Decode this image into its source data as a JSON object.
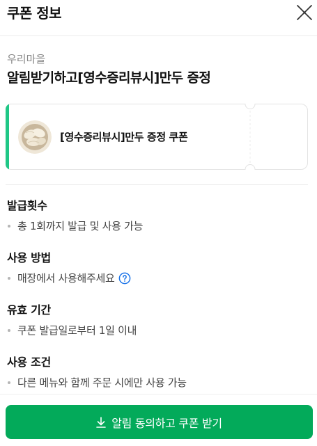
{
  "header": {
    "title": "쿠폰 정보",
    "close_icon": "close-icon"
  },
  "coupon": {
    "store": "우리마을",
    "headline": "알림받기하고[영수증리뷰시]만두 증정",
    "ticket_label": "[영수증리뷰시]만두 증정 쿠폰",
    "accent_color": "#1fc786"
  },
  "details": [
    {
      "title": "발급횟수",
      "text": "총 1회까지 발급 및 사용 가능"
    },
    {
      "title": "사용 방법",
      "text": "매장에서 사용해주세요",
      "icon": "help-circle-icon"
    },
    {
      "title": "유효 기간",
      "text": "쿠폰 발급일로부터 1일 이내"
    },
    {
      "title": "사용 조건",
      "text": "다른 메뉴와 함께 주문 시에만 사용 가능"
    }
  ],
  "cta": {
    "label": "알림 동의하고 쿠폰 받기",
    "icon": "download-icon",
    "color": "#03aa5a"
  }
}
